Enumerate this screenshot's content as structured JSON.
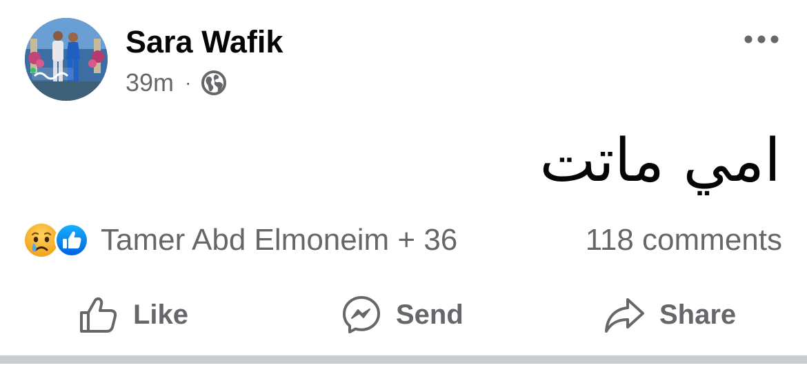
{
  "post": {
    "author": {
      "name": "Sara Wafik",
      "avatar_icon": "profile-photo"
    },
    "meta": {
      "time": "39m",
      "separator": "·",
      "audience_icon": "globe-icon"
    },
    "more_icon": "more-dots-icon",
    "text": "امي ماتت",
    "reactions": {
      "icons": [
        "sad-reaction-icon",
        "like-reaction-icon"
      ],
      "summary": "Tamer Abd Elmoneim + 36"
    },
    "comments": "118 comments"
  },
  "actions": {
    "like_label": "Like",
    "send_label": "Send",
    "share_label": "Share"
  },
  "colors": {
    "text_primary": "#050505",
    "text_secondary": "#65676b",
    "like_blue": "#1877f2",
    "sad_yellow": "#f7b125",
    "divider": "#c9ccd1"
  }
}
